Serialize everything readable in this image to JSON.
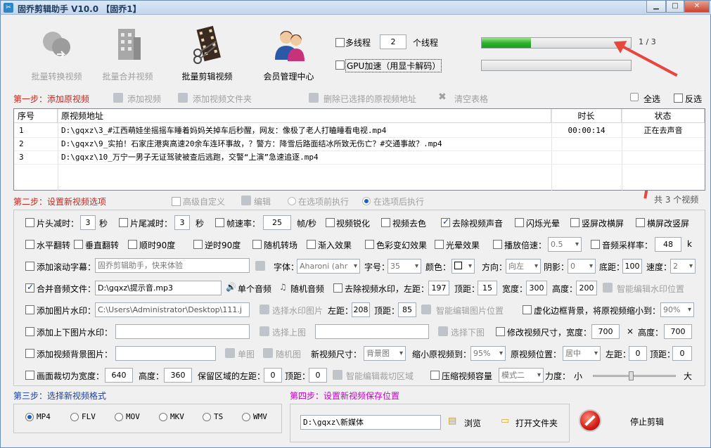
{
  "window": {
    "title": "固乔剪辑助手 V10.0  【固乔1】",
    "app_icon": "scissors-icon"
  },
  "toolbar": {
    "batch_convert": "批量转换视频",
    "batch_merge": "批量合并视频",
    "batch_edit": "批量剪辑视频",
    "member_center": "会员管理中心"
  },
  "threads": {
    "label": "多线程",
    "value": "2",
    "unit": "个线程"
  },
  "gpu": {
    "label": "GPU加速（用显卡解码）"
  },
  "progress": {
    "text": "1 / 3",
    "fraction_1": 0.33,
    "fraction_2": 0.0
  },
  "step1": {
    "title": "第一步：添加原视频",
    "add_video": "添加视频",
    "add_folder": "添加视频文件夹",
    "delete_selected": "删除已选择的原视频地址",
    "clear_table": "清空表格",
    "select_all": "全选",
    "invert": "反选"
  },
  "table": {
    "headers": [
      "序号",
      "原视频地址",
      "时长",
      "状态"
    ],
    "rows": [
      {
        "no": "1",
        "path": "D:\\gqxz\\3_#江西萌娃坐摇摇车睡着妈妈关掉车后秒醒，网友：像极了老人打瞌睡看电视.mp4",
        "duration": "00:00:14",
        "status": "正在去声音"
      },
      {
        "no": "2",
        "path": "D:\\gqxz\\9_实拍！石家庄港爽高速20余车连环事故，？警方：降雪后路面结冰所致无伤亡？#交通事故？.mp4",
        "duration": "",
        "status": ""
      },
      {
        "no": "3",
        "path": "D:\\gqxz\\10_万宁一男子无证驾驶被查后逃跑，交警“上演”急速追逐.mp4",
        "duration": "",
        "status": ""
      }
    ],
    "count_text": "共 3 个视频"
  },
  "step2": {
    "title": "第二步：设置新视频选项",
    "advanced": "高级自定义",
    "edit": "编辑",
    "before": "在选项前执行",
    "after": "在选项后执行"
  },
  "opts": {
    "head_cut": "片头减时：",
    "head_val": "3",
    "sec1": "秒",
    "tail_cut": "片尾减时：",
    "tail_val": "3",
    "sec2": "秒",
    "fps": "帧速率：",
    "fps_val": "25",
    "fps_unit": "帧/秒",
    "sharpen": "视频锐化",
    "decolor": "视频去色",
    "remove_audio": "去除视频声音",
    "flash": "闪烁光晕",
    "v2h": "竖屏改横屏",
    "h2v": "横屏改竖屏",
    "hflip": "水平翻转",
    "vflip": "垂直翻转",
    "rot90": "顺时90度",
    "rot_ccw90": "逆时90度",
    "rand_trans": "随机转场",
    "fade_in": "渐入效果",
    "color_fx": "色彩变幻效果",
    "halo": "光晕效果",
    "speed": "播放倍速：",
    "speed_val": "0.5",
    "samplerate": "音频采样率：",
    "sr_val": "48",
    "sr_unit": "k",
    "scroll_sub": "添加滚动字幕：",
    "scroll_text": "固乔剪辑助手，快来体验",
    "font": "字体：",
    "font_val": "Aharoni (ahr",
    "size": "字号：",
    "size_val": "35",
    "color": "颜色：",
    "dir": "方向：",
    "dir_val": "向左",
    "shadow": "阴影：",
    "shadow_val": "0",
    "bottom": "底距：",
    "bottom_val": "100",
    "spd": "速度：",
    "spd_val": "2",
    "merge_audio": "合并音频文件：",
    "audio_path": "D:\\gqxz\\提示音.mp3",
    "single_audio": "单个音频",
    "random_audio": "随机音频",
    "rm_watermark": "去除视频水印，左距：",
    "wm_left": "197",
    "wm_top_l": "顶距：",
    "wm_top": "15",
    "wm_w_l": "宽度：",
    "wm_w": "300",
    "wm_h_l": "高度：",
    "wm_h": "200",
    "smart_wm": "智能编辑水印位置",
    "img_wm": "添加图片水印：",
    "img_path": "C:\\Users\\Administrator\\Desktop\\111.j",
    "choose_wm": "选择水印图片",
    "img_left_l": "左距：",
    "img_left": "208",
    "img_top_l": "顶距：",
    "img_top": "85",
    "smart_img": "智能编辑图片位置",
    "blur_bg": "虚化边框背景，将原视频缩小到：",
    "blur_val": "90%",
    "tb_img": "添加上下图片水印：",
    "choose_top": "选择上图",
    "choose_bottom": "选择下图",
    "resize": "修改视频尺寸，宽度：",
    "rw": "700",
    "times": "×",
    "rh_l": "高度：",
    "rh": "700",
    "bg_img": "添加视频背景图片：",
    "single_img": "单图",
    "random_img": "随机图",
    "new_size": "新视频尺寸：",
    "new_size_val": "背景图",
    "shrink": "缩小原视频到：",
    "shrink_val": "95%",
    "pos": "原视频位置：",
    "pos_val": "居中",
    "left2": "左距：",
    "left2_val": "0",
    "top2": "顶距：",
    "top2_val": "0",
    "crop": "画面裁切为宽度：",
    "crop_w": "640",
    "crop_h_l": "高度：",
    "crop_h": "360",
    "keep_left": "保留区域的左距：",
    "keep_left_val": "0",
    "keep_top": "顶距：",
    "keep_top_val": "0",
    "smart_crop": "智能编辑裁切区域",
    "compress": "压缩视频容量",
    "mode_val": "模式二",
    "strength": "力度：",
    "small": "小",
    "large": "大",
    "strength_level": 0.45
  },
  "step3": {
    "title": "第三步：选择新视频格式",
    "formats": [
      "MP4",
      "FLV",
      "MOV",
      "MKV",
      "TS",
      "WMV"
    ]
  },
  "step4": {
    "title": "第四步：设置新视频保存位置",
    "path": "D:\\gqxz\\新媒体",
    "browse": "浏览",
    "open_folder": "打开文件夹"
  },
  "stop": {
    "label": "停止剪辑"
  }
}
